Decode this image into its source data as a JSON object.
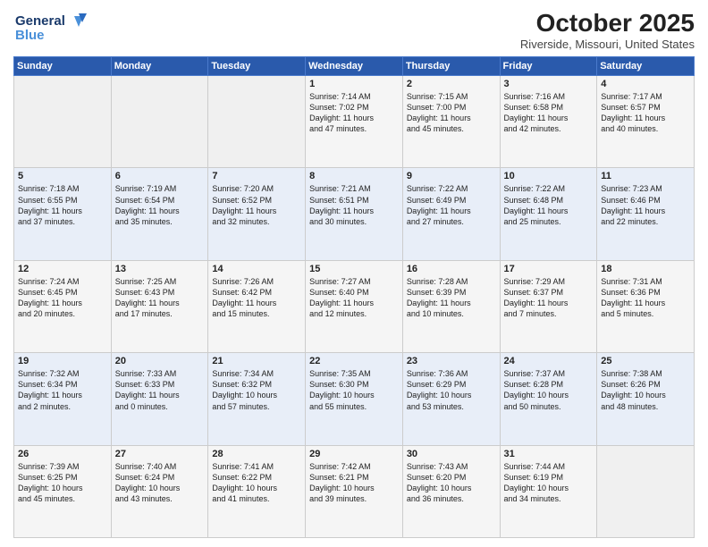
{
  "logo": {
    "line1": "General",
    "line2": "Blue"
  },
  "title": "October 2025",
  "location": "Riverside, Missouri, United States",
  "weekdays": [
    "Sunday",
    "Monday",
    "Tuesday",
    "Wednesday",
    "Thursday",
    "Friday",
    "Saturday"
  ],
  "weeks": [
    [
      {
        "day": "",
        "info": ""
      },
      {
        "day": "",
        "info": ""
      },
      {
        "day": "",
        "info": ""
      },
      {
        "day": "1",
        "info": "Sunrise: 7:14 AM\nSunset: 7:02 PM\nDaylight: 11 hours\nand 47 minutes."
      },
      {
        "day": "2",
        "info": "Sunrise: 7:15 AM\nSunset: 7:00 PM\nDaylight: 11 hours\nand 45 minutes."
      },
      {
        "day": "3",
        "info": "Sunrise: 7:16 AM\nSunset: 6:58 PM\nDaylight: 11 hours\nand 42 minutes."
      },
      {
        "day": "4",
        "info": "Sunrise: 7:17 AM\nSunset: 6:57 PM\nDaylight: 11 hours\nand 40 minutes."
      }
    ],
    [
      {
        "day": "5",
        "info": "Sunrise: 7:18 AM\nSunset: 6:55 PM\nDaylight: 11 hours\nand 37 minutes."
      },
      {
        "day": "6",
        "info": "Sunrise: 7:19 AM\nSunset: 6:54 PM\nDaylight: 11 hours\nand 35 minutes."
      },
      {
        "day": "7",
        "info": "Sunrise: 7:20 AM\nSunset: 6:52 PM\nDaylight: 11 hours\nand 32 minutes."
      },
      {
        "day": "8",
        "info": "Sunrise: 7:21 AM\nSunset: 6:51 PM\nDaylight: 11 hours\nand 30 minutes."
      },
      {
        "day": "9",
        "info": "Sunrise: 7:22 AM\nSunset: 6:49 PM\nDaylight: 11 hours\nand 27 minutes."
      },
      {
        "day": "10",
        "info": "Sunrise: 7:22 AM\nSunset: 6:48 PM\nDaylight: 11 hours\nand 25 minutes."
      },
      {
        "day": "11",
        "info": "Sunrise: 7:23 AM\nSunset: 6:46 PM\nDaylight: 11 hours\nand 22 minutes."
      }
    ],
    [
      {
        "day": "12",
        "info": "Sunrise: 7:24 AM\nSunset: 6:45 PM\nDaylight: 11 hours\nand 20 minutes."
      },
      {
        "day": "13",
        "info": "Sunrise: 7:25 AM\nSunset: 6:43 PM\nDaylight: 11 hours\nand 17 minutes."
      },
      {
        "day": "14",
        "info": "Sunrise: 7:26 AM\nSunset: 6:42 PM\nDaylight: 11 hours\nand 15 minutes."
      },
      {
        "day": "15",
        "info": "Sunrise: 7:27 AM\nSunset: 6:40 PM\nDaylight: 11 hours\nand 12 minutes."
      },
      {
        "day": "16",
        "info": "Sunrise: 7:28 AM\nSunset: 6:39 PM\nDaylight: 11 hours\nand 10 minutes."
      },
      {
        "day": "17",
        "info": "Sunrise: 7:29 AM\nSunset: 6:37 PM\nDaylight: 11 hours\nand 7 minutes."
      },
      {
        "day": "18",
        "info": "Sunrise: 7:31 AM\nSunset: 6:36 PM\nDaylight: 11 hours\nand 5 minutes."
      }
    ],
    [
      {
        "day": "19",
        "info": "Sunrise: 7:32 AM\nSunset: 6:34 PM\nDaylight: 11 hours\nand 2 minutes."
      },
      {
        "day": "20",
        "info": "Sunrise: 7:33 AM\nSunset: 6:33 PM\nDaylight: 11 hours\nand 0 minutes."
      },
      {
        "day": "21",
        "info": "Sunrise: 7:34 AM\nSunset: 6:32 PM\nDaylight: 10 hours\nand 57 minutes."
      },
      {
        "day": "22",
        "info": "Sunrise: 7:35 AM\nSunset: 6:30 PM\nDaylight: 10 hours\nand 55 minutes."
      },
      {
        "day": "23",
        "info": "Sunrise: 7:36 AM\nSunset: 6:29 PM\nDaylight: 10 hours\nand 53 minutes."
      },
      {
        "day": "24",
        "info": "Sunrise: 7:37 AM\nSunset: 6:28 PM\nDaylight: 10 hours\nand 50 minutes."
      },
      {
        "day": "25",
        "info": "Sunrise: 7:38 AM\nSunset: 6:26 PM\nDaylight: 10 hours\nand 48 minutes."
      }
    ],
    [
      {
        "day": "26",
        "info": "Sunrise: 7:39 AM\nSunset: 6:25 PM\nDaylight: 10 hours\nand 45 minutes."
      },
      {
        "day": "27",
        "info": "Sunrise: 7:40 AM\nSunset: 6:24 PM\nDaylight: 10 hours\nand 43 minutes."
      },
      {
        "day": "28",
        "info": "Sunrise: 7:41 AM\nSunset: 6:22 PM\nDaylight: 10 hours\nand 41 minutes."
      },
      {
        "day": "29",
        "info": "Sunrise: 7:42 AM\nSunset: 6:21 PM\nDaylight: 10 hours\nand 39 minutes."
      },
      {
        "day": "30",
        "info": "Sunrise: 7:43 AM\nSunset: 6:20 PM\nDaylight: 10 hours\nand 36 minutes."
      },
      {
        "day": "31",
        "info": "Sunrise: 7:44 AM\nSunset: 6:19 PM\nDaylight: 10 hours\nand 34 minutes."
      },
      {
        "day": "",
        "info": ""
      }
    ]
  ]
}
